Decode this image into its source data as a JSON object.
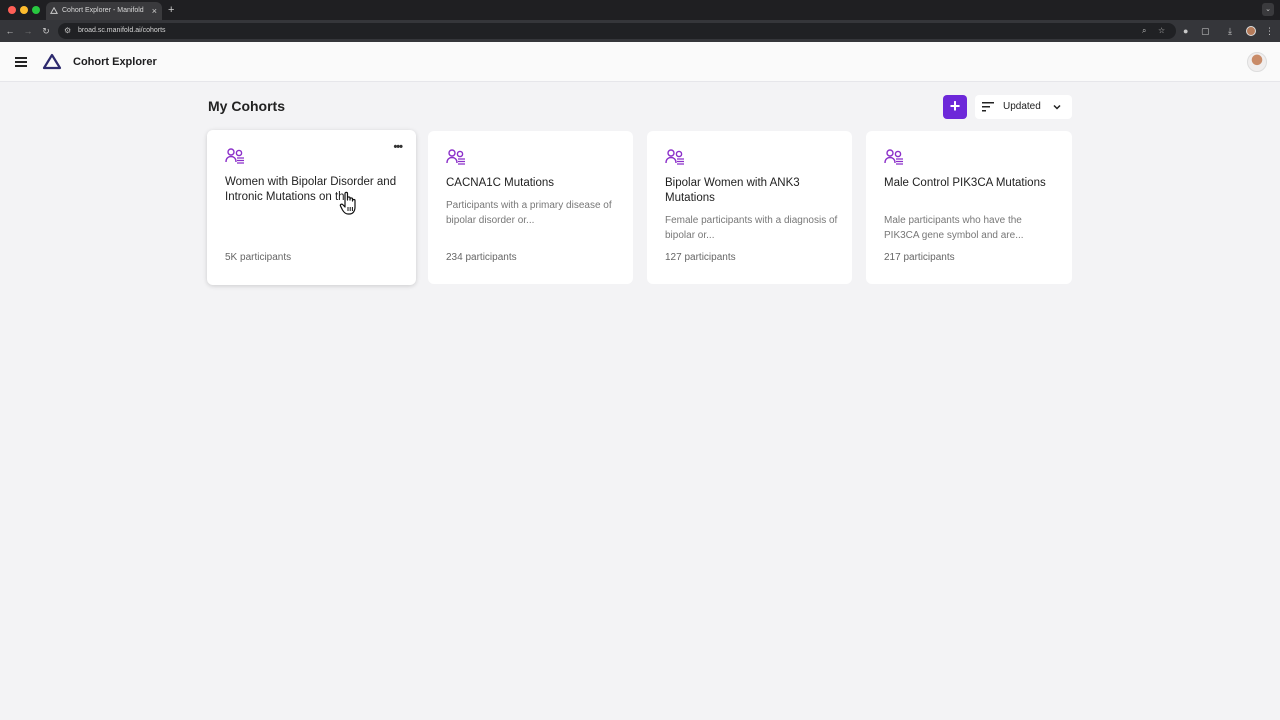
{
  "browser": {
    "tab_title": "Cohort Explorer - Manifold",
    "tab_close": "×",
    "new_tab": "+",
    "url": "broad.sc.manifold.ai/cohorts"
  },
  "app": {
    "title": "Cohort Explorer"
  },
  "page": {
    "title": "My Cohorts",
    "add_label": "+",
    "sort_label": "Updated"
  },
  "cohorts": [
    {
      "title": "Women with Bipolar Disorder and Intronic Mutations on th...",
      "description": "",
      "count": "5K participants",
      "more": "•••"
    },
    {
      "title": "CACNA1C Mutations",
      "description": "Participants with a primary disease of bipolar disorder or...",
      "count": "234 participants"
    },
    {
      "title": "Bipolar Women with ANK3 Mutations",
      "description": "Female participants with a diagnosis of bipolar or...",
      "count": "127 participants"
    },
    {
      "title": "Male Control PIK3CA Mutations",
      "description": "Male participants who have the PIK3CA gene symbol and are...",
      "count": "217 participants"
    }
  ],
  "colors": {
    "accent": "#6d28d9",
    "icon_purple": "#8b2fc9",
    "background": "#f3f3f5"
  }
}
